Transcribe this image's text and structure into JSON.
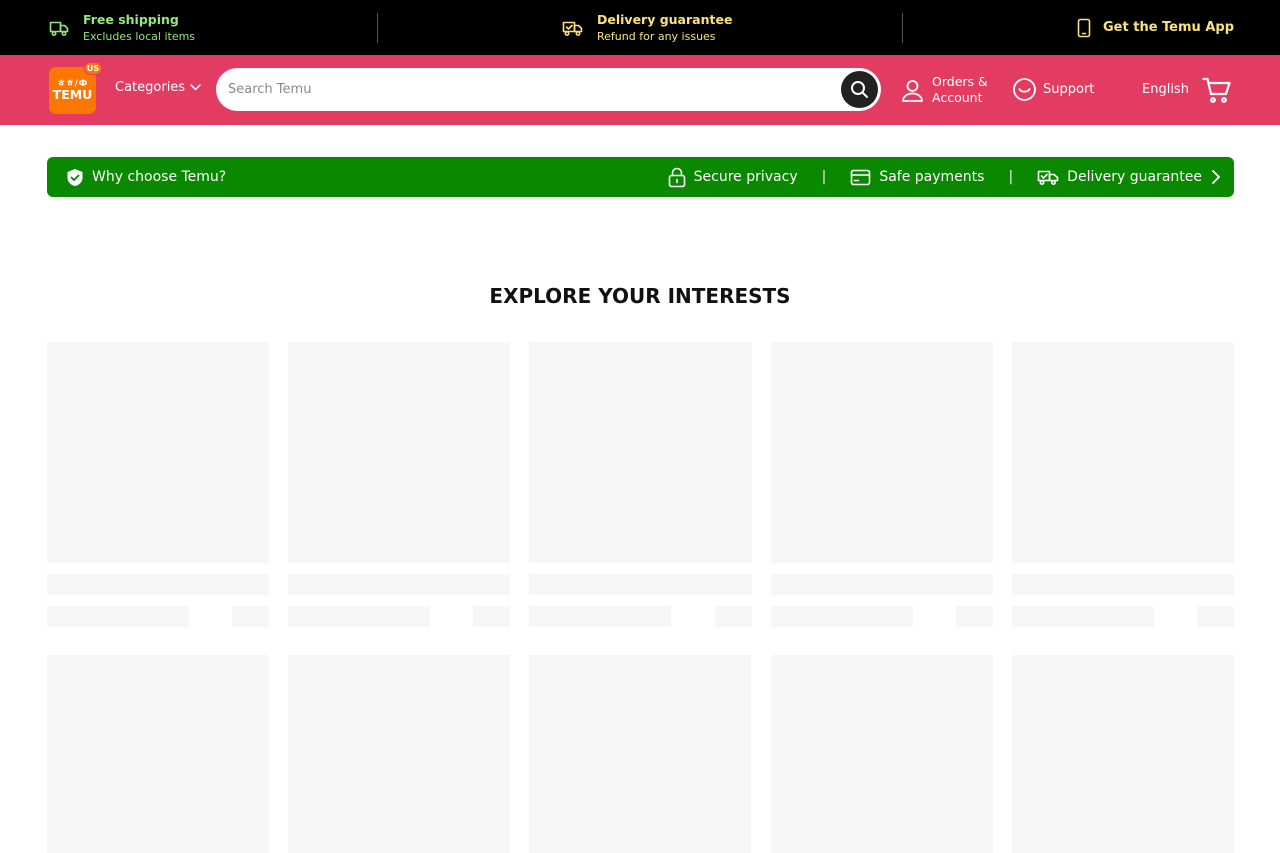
{
  "promo": {
    "shipping_title": "Free shipping",
    "shipping_sub": "Excludes local items",
    "delivery_title": "Delivery guarantee",
    "delivery_sub": "Refund for any issues",
    "app_label": "Get the Temu App"
  },
  "header": {
    "logo_top": "ㅎㅎ/Ф",
    "logo_text": "TEMU",
    "logo_badge": "US",
    "categories_label": "Categories",
    "search_placeholder": "Search Temu",
    "orders_line1": "Orders &",
    "orders_line2": "Account",
    "support_label": "Support",
    "language_label": "English"
  },
  "why_bar": {
    "label": "Why choose Temu?",
    "secure_label": "Secure privacy",
    "payments_label": "Safe payments",
    "delivery_label": "Delivery guarantee",
    "separator": "|"
  },
  "section": {
    "title": "EXPLORE YOUR INTERESTS"
  },
  "colors": {
    "promo_bg": "#000000",
    "header_bg": "#e33c63",
    "logo_bg": "#fb7701",
    "why_bar_bg": "#0a8800",
    "promo_green": "#95e67b",
    "promo_yellow": "#fbe27b",
    "skeleton": "#f6f6f6"
  },
  "icons": {
    "shipping": "truck-icon",
    "delivery": "delivery-truck-check-icon",
    "app": "phone-icon",
    "categories": "chevron-down-icon",
    "search": "search-icon",
    "orders": "user-icon",
    "support": "smile-icon",
    "cart": "cart-icon",
    "why": "shield-check-icon",
    "secure": "lock-icon",
    "payments": "card-icon",
    "why_delivery": "delivery-truck-check-icon",
    "why_more": "chevron-right-icon"
  }
}
